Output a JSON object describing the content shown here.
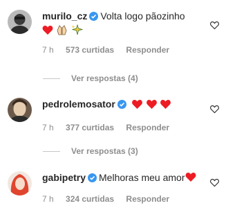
{
  "comments": [
    {
      "username": "murilo_cz",
      "text": "Volta logo pãozinho",
      "emojis": [
        "heart",
        "folded-hands",
        "sparkles"
      ],
      "time": "7 h",
      "likes": "573 curtidas",
      "reply_label": "Responder",
      "view_replies": "Ver respostas (4)"
    },
    {
      "username": "pedrolemosator",
      "text": "",
      "emojis": [
        "heart",
        "heart",
        "heart"
      ],
      "time": "7 h",
      "likes": "377 curtidas",
      "reply_label": "Responder",
      "view_replies": "Ver respostas (3)"
    },
    {
      "username": "gabipetry",
      "text": "Melhoras meu amor",
      "emojis": [
        "heart"
      ],
      "time": "7 h",
      "likes": "324 curtidas",
      "reply_label": "Responder"
    }
  ],
  "colors": {
    "verified": "#3897f0",
    "heart": "#ed1c24",
    "meta_text": "#8e8e8e"
  }
}
